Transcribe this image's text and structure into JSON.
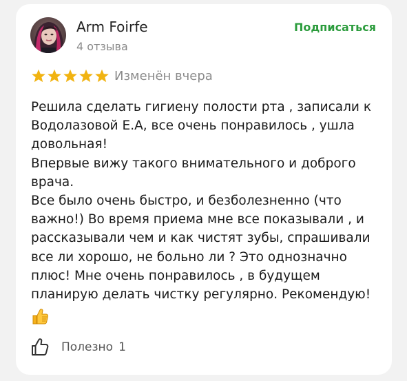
{
  "colors": {
    "accent": "#2c9c3d",
    "star": "#f1b311",
    "secondary_text": "#8a8a8a",
    "background": "#f2f2f2",
    "card": "#ffffff"
  },
  "review": {
    "author": {
      "name": "Arm Foirfe",
      "reviews_count": "4 отзыва"
    },
    "subscribe_label": "Подписаться",
    "rating": 5,
    "rating_max": 5,
    "edited_label": "Изменён вчера",
    "paragraphs": [
      "Решила сделать гигиену полости рта , записали к Водолазовой Е.А, все очень понравилось , ушла довольная!",
      "Впервые вижу такого внимательного и доброго врача.",
      "Все было очень быстро, и безболезненно (что важно!) Во время приема мне все показывали , и рассказывали чем и как чистят зубы, спрашивали все ли хорошо, не больно ли ? Это однозначно плюс! Мне очень понравилось , в будущем планирую делать чистку регулярно. Рекомендую!"
    ],
    "emoji_icon": "thumbs-up-emoji-icon",
    "helpful": {
      "label": "Полезно",
      "count": "1",
      "icon": "thumbs-up-outline-icon"
    }
  }
}
